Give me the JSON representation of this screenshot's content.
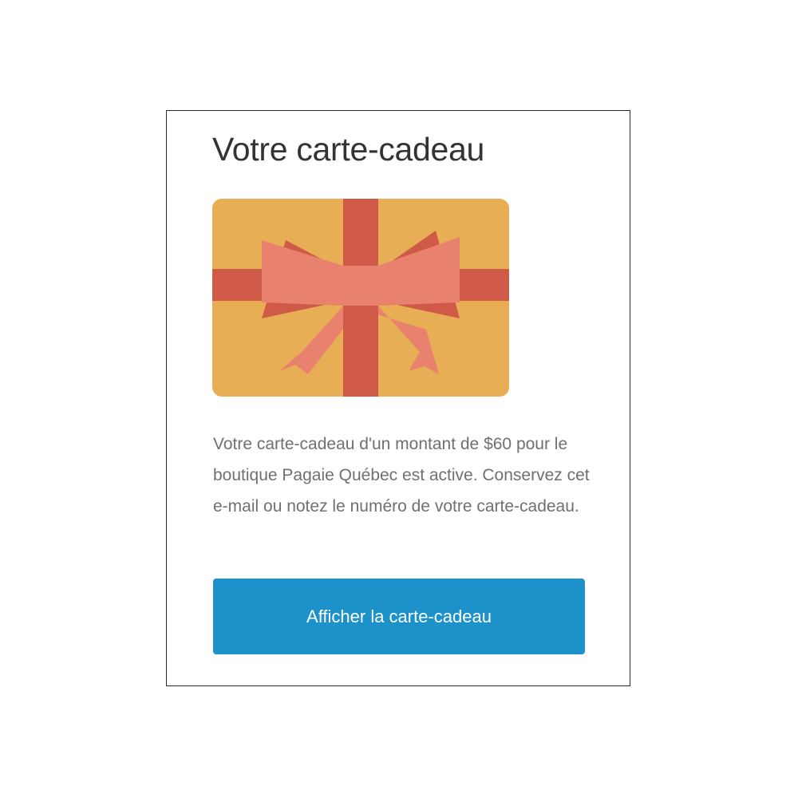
{
  "card": {
    "title": "Votre carte-cadeau",
    "message": "Votre carte-cadeau d'un montant de $60 pour le boutique Pagaie Québec est active. Conservez cet e-mail ou notez le numéro de votre carte-cadeau.",
    "button_label": "Afficher la carte-cadeau"
  },
  "illustration": {
    "name": "gift-card-illustration",
    "card_color": "#e8ae55",
    "ribbon_color": "#d05a48",
    "bow_color": "#e8826e"
  },
  "colors": {
    "button_bg": "#1d91c9",
    "button_text": "#ffffff",
    "title_text": "#333333",
    "body_text": "#707070",
    "border": "#2b2b2b"
  }
}
